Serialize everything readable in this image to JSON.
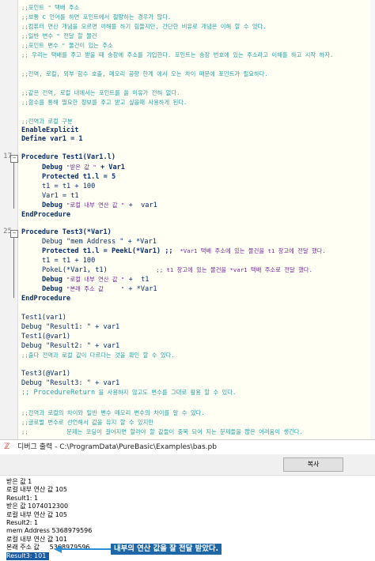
{
  "code": {
    "c1": ";;포인트 \" 택배 주소",
    "c2": ";;보통 C 언어를 하면 포인트에서 절망하는 경우가 많다.",
    "c3": ";;컴퓨터 연산 개념을 모르면 이해를 하기 힘들지만, 간단한 비유로 개념은 이해 할 수 있다.",
    "c4": ";;일반 변수 \" 전달 할 물건",
    "c5": ";;포인트 변수 \" 물건이 있는 주소",
    "c6": ";; 우리는 택배를 주고 받을 때 송장에 주소를 기입한다. 포인트는 송장 번호에 있는 주소라고 이해를 하고 시작 하자.",
    "c7": ";;전역, 로컬, 외부 함수 호출, 메모리 공항 한계 에서 오는 차이 때문에 포인트가 필요하다.",
    "c8": ";;같은 전역, 로컬 내에서는 포인트를 쓸 이유가 전혀 없다.",
    "c9": ";;함수를 통해 필요한 정보를 주고 받고 싶을때 사용하게 된다.",
    "c10": ";;전역과 로컬 구분",
    "enable": "EnableExplicit",
    "define": "Define var1 = 1",
    "proc1": "Procedure Test1(Var1.l)",
    "p1l1a": "Debug ",
    "p1l1b": "\"받은 값 \"",
    "p1l1c": " + Var1",
    "p1l2": "Protected t1.l = 5",
    "p1l3": "t1 = t1 + 100",
    "p1l4": "Var1 = t1",
    "p1l5a": "Debug ",
    "p1l5b": "\"로컬 내부 연산 값 \"",
    "p1l5c": " +  var1",
    "endp1": "EndProcedure",
    "proc2": "Procedure Test3(*Var1)",
    "p2l1": "Debug \"mem Address \" + *Var1",
    "p2l2a": "Protected t1.l = PeekL(*Var1) ;;",
    "p2l2b": "  *Var1 택배 주소에 있는 물건을 t1 창고에 전달 했다.",
    "p2l3": "t1 = t1 + 100",
    "p2l4a": "PokeL(*Var1, t1)",
    "p2l4b": "              ;; t1 창고에 있는 물건을 *var1 택배 주소로 전달 했다.",
    "p2l5a": "Debug ",
    "p2l5b": "\"로컬 내부 연산 값 \"",
    "p2l5c": " +  t1",
    "p2l6a": "Debug ",
    "p2l6b": "\"본래 주소 값     \"",
    "p2l6c": " + *Var1",
    "endp2": "EndProcedure",
    "m1": "Test1(var1)",
    "m2": "Debug \"Result1: \" + var1",
    "m3": "Test1(@var1)",
    "m4": "Debug \"Result2: \" + var1",
    "c11": ";;출다 전역과 로컬 값이 다르다는 것을 확인 할 수 있다.",
    "m5": "Test3(@Var1)",
    "m6": "Debug \"Result3: \" + var1",
    "m7a": ";; ProcedureReturn",
    "m7b": " 을 사용하지 않고도 변수를 그대로 활용 할 수 있다.",
    "c12": ";;전역과 로컬의 차이와 일반 변수 메모리 변수의 차이를 알 수 있다.",
    "c13": ";;글로벌 변수로 선언해서 값을 유지 할 수 있지만",
    "c14": ";;           문제는 코딩이 길어지면 할라야 할 값들이 중복 되어 지는 문제들을 많은 어려움이 생긴다."
  },
  "line_numbers": [
    "17",
    "25"
  ],
  "debug_window": {
    "title": "디버그 출력 - C:\\ProgramData\\PureBasic\\Examples\\bas.pb",
    "copy_label": "복사",
    "output": [
      "받은 값 1",
      "로컬 내부 연산 값 105",
      "Result1: 1",
      "받은 값 1074012300",
      "로컬 내부 연산 값 105",
      "Result2: 1",
      "mem Address 5368979596",
      "로컬 내부 연산 값 101",
      "본래 주소 값     5368979596",
      "Result3: 101"
    ]
  },
  "annotation": "내부의 연산 값을 잘 전달 받았다."
}
